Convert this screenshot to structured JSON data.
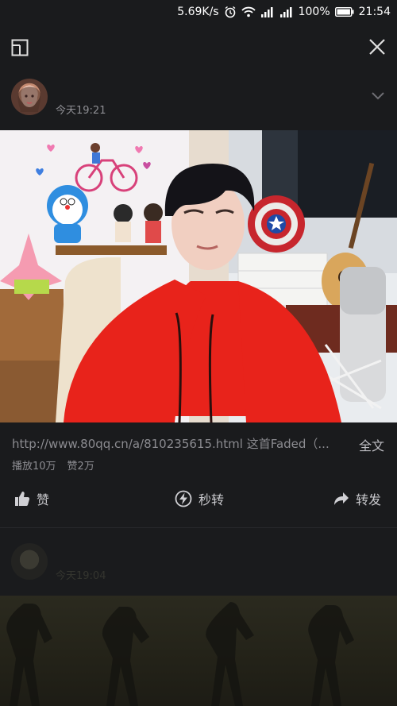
{
  "status_bar": {
    "speed": "5.69K/s",
    "battery": "100%",
    "time": "21:54"
  },
  "top_bar": {
    "icons": [
      "mini-window-icon",
      "close-icon"
    ]
  },
  "post": {
    "time": "今天19:21",
    "caption": "http://www.80qq.cn/a/810235615.html 这首Faded（...",
    "full_text_label": "全文",
    "plays": "播放10万",
    "likes_count": "赞2万"
  },
  "actions": {
    "like_label": "赞",
    "quick_repost_label": "秒转",
    "repost_label": "转发"
  },
  "next_post": {
    "time": "今天19:04"
  },
  "colors": {
    "background": "#1a1b1d",
    "hoodie": "#e8231b",
    "text_secondary": "#8e8e93"
  }
}
